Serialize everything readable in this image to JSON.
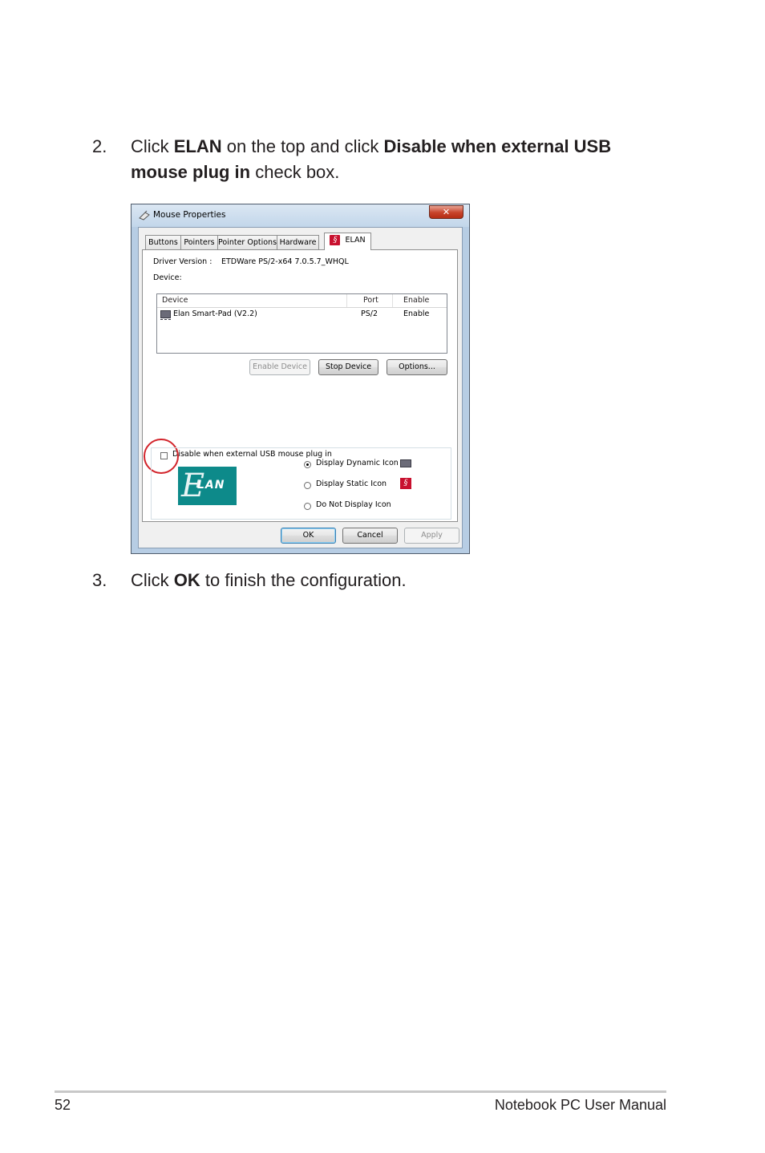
{
  "steps": [
    {
      "number": "2.",
      "parts": [
        {
          "t": "Click ",
          "b": false
        },
        {
          "t": "ELAN",
          "b": true
        },
        {
          "t": " on the top and click ",
          "b": false
        },
        {
          "t": "Disable when external USB mouse plug in",
          "b": true
        },
        {
          "t": " check box.",
          "b": false
        }
      ]
    },
    {
      "number": "3.",
      "parts": [
        {
          "t": "Click ",
          "b": false
        },
        {
          "t": "OK",
          "b": true
        },
        {
          "t": " to finish the configuration.",
          "b": false
        }
      ]
    }
  ],
  "dialog": {
    "title": "Mouse Properties",
    "close_glyph": "✕",
    "tabs": [
      "Buttons",
      "Pointers",
      "Pointer Options",
      "Hardware",
      "ELAN"
    ],
    "active_tab": "ELAN",
    "driver_version_label": "Driver Version :",
    "driver_version_value": "ETDWare PS/2-x64 7.0.5.7_WHQL",
    "device_label": "Device:",
    "list": {
      "columns": [
        "Device",
        "Port",
        "Enable"
      ],
      "rows": [
        {
          "device": "Elan Smart-Pad  (V2.2)",
          "port": "PS/2",
          "enable": "Enable"
        }
      ]
    },
    "buttons": {
      "enable_device": "Enable Device",
      "stop_device": "Stop Device",
      "options": "Options...",
      "ok": "OK",
      "cancel": "Cancel",
      "apply": "Apply"
    },
    "checkbox": {
      "label": "Disable when external USB mouse plug in",
      "checked": false
    },
    "logo_text": {
      "E": "E",
      "rest": "LAN"
    },
    "icon_display": {
      "options": [
        "Display Dynamic Icon",
        "Display Static Icon",
        "Do Not Display Icon"
      ],
      "selected": "Display Dynamic Icon"
    },
    "icons": {
      "elan": "elan-icon",
      "touchpad": "touchpad-icon",
      "mouse": "mouse-icon"
    },
    "highlight_color": "#d2232a"
  },
  "footer": {
    "page_number": "52",
    "manual_title": "Notebook PC User Manual"
  }
}
